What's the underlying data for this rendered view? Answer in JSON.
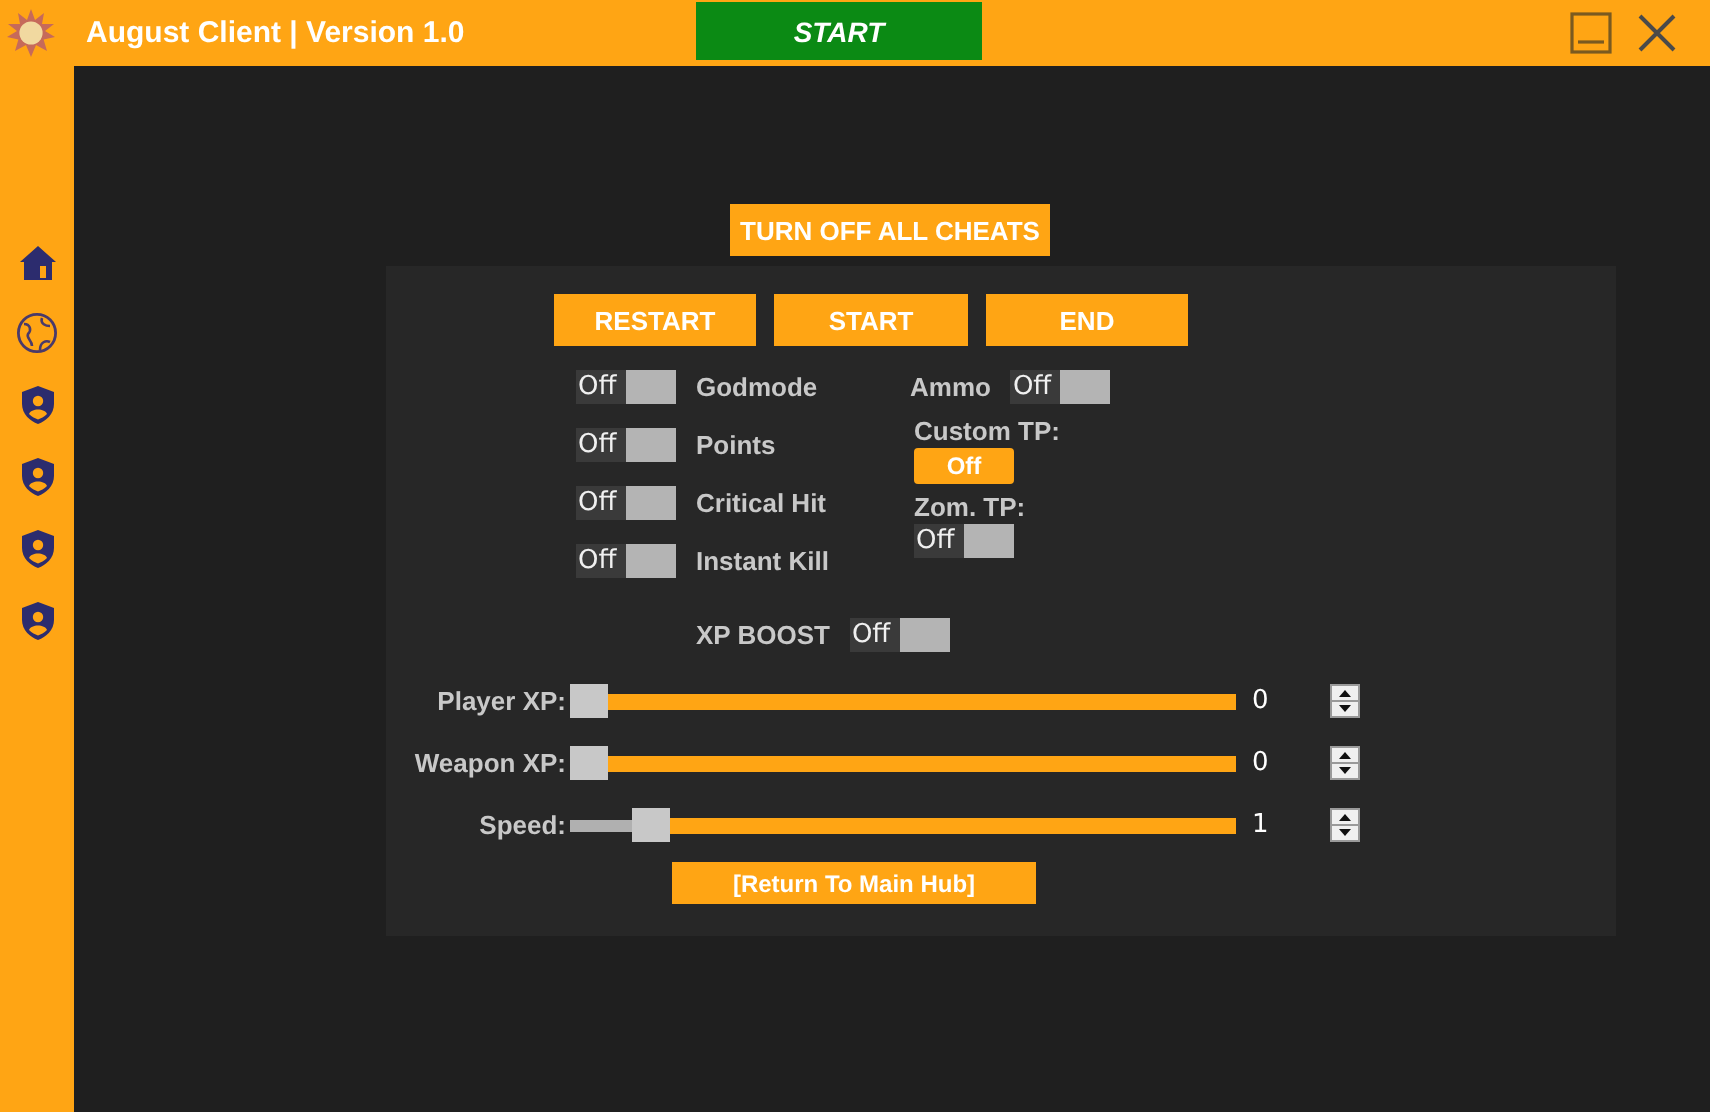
{
  "window": {
    "title": "August Client | Version 1.0"
  },
  "title_bar": {
    "start_button": "START"
  },
  "sidebar": {
    "items": [
      {
        "kind": "home"
      },
      {
        "kind": "globe"
      },
      {
        "kind": "shield"
      },
      {
        "kind": "shield"
      },
      {
        "kind": "shield"
      },
      {
        "kind": "shield"
      }
    ]
  },
  "actions": {
    "turn_off_all": "TURN OFF ALL CHEATS",
    "buttons": [
      "RESTART",
      "START",
      "END"
    ]
  },
  "cheats": [
    {
      "label": "Godmode",
      "kind": "toggle",
      "on": false,
      "state_label": "Off"
    },
    {
      "label": "Points",
      "kind": "toggle",
      "on": false,
      "state_label": "Off"
    },
    {
      "label": "Critical Hit",
      "kind": "toggle",
      "on": false,
      "state_label": "Off"
    },
    {
      "label": "Instant Kill",
      "kind": "toggle",
      "on": false,
      "state_label": "Off"
    }
  ],
  "right_cheats": [
    {
      "label": "Ammo",
      "kind": "toggle",
      "on": false,
      "state_label": "Off"
    },
    {
      "label": "Custom TP:",
      "kind": "button",
      "value": "Off"
    },
    {
      "label": "Zom. TP:",
      "kind": "toggle",
      "on": false,
      "state_label": "Off"
    }
  ],
  "xp_boost": {
    "label": "XP BOOST",
    "on": false,
    "state_label": "Off"
  },
  "sliders": [
    {
      "label": "Player XP:",
      "level": 0,
      "value": "0"
    },
    {
      "label": "Weapon XP:",
      "level": 0,
      "value": "0"
    },
    {
      "label": "Speed:",
      "level": 0.1,
      "value": "1"
    }
  ],
  "return_button": "[Return To Main Hub]"
}
